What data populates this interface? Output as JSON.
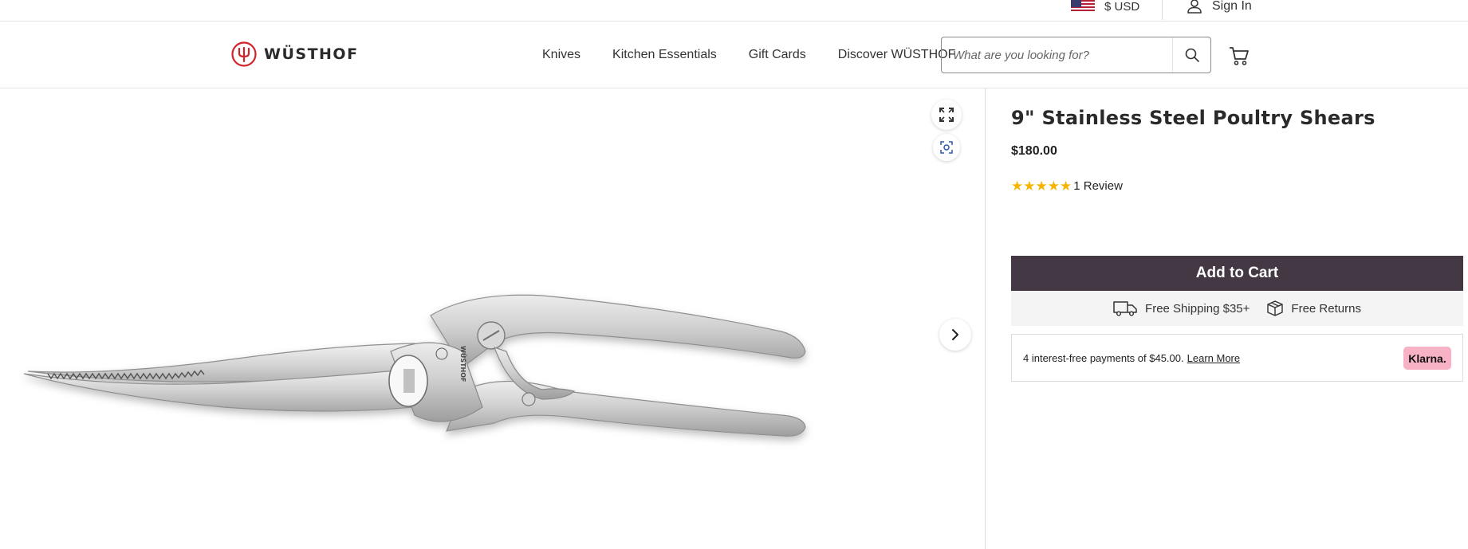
{
  "utility": {
    "currency": "$ USD",
    "sign_in": "Sign In"
  },
  "header": {
    "logo_text": "WÜSTHOF",
    "nav": [
      {
        "label": "Knives"
      },
      {
        "label": "Kitchen Essentials"
      },
      {
        "label": "Gift Cards"
      },
      {
        "label": "Discover WÜSTHOF"
      }
    ],
    "search_placeholder": "What are you looking for?"
  },
  "gallery": {
    "icons": [
      "expand-icon",
      "view-in-room-icon",
      "chevron-right-icon"
    ],
    "engraving": "WÜSTHOF"
  },
  "product": {
    "title": "9\" Stainless Steel Poultry Shears",
    "price": "$180.00",
    "rating_stars": 5,
    "reviews": "1 Review",
    "add_to_cart": "Add to Cart",
    "perks": [
      {
        "label": "Free Shipping $35+",
        "icon": "truck-icon"
      },
      {
        "label": "Free Returns",
        "icon": "box-icon"
      }
    ],
    "klarna": {
      "text": "4 interest-free payments of $45.00.",
      "link": "Learn More",
      "badge": "Klarna."
    }
  },
  "colors": {
    "brand_red": "#d2232a",
    "cart_button": "#433843",
    "star": "#f4b400",
    "klarna_pink": "#f7b2c6"
  }
}
